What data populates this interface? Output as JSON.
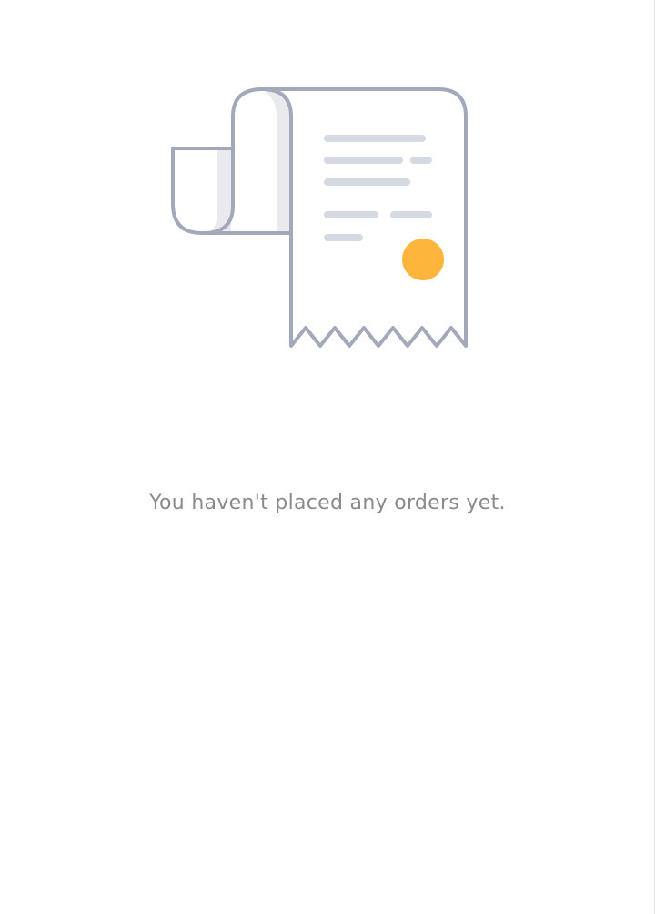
{
  "empty_state": {
    "icon": "receipt-icon",
    "message": "You haven't placed any orders yet."
  },
  "colors": {
    "outline": "#a3a9bb",
    "line": "#d5dae2",
    "curl_shade": "#e8eaee",
    "seal": "#fdb53b",
    "text": "#8a8a8a"
  }
}
